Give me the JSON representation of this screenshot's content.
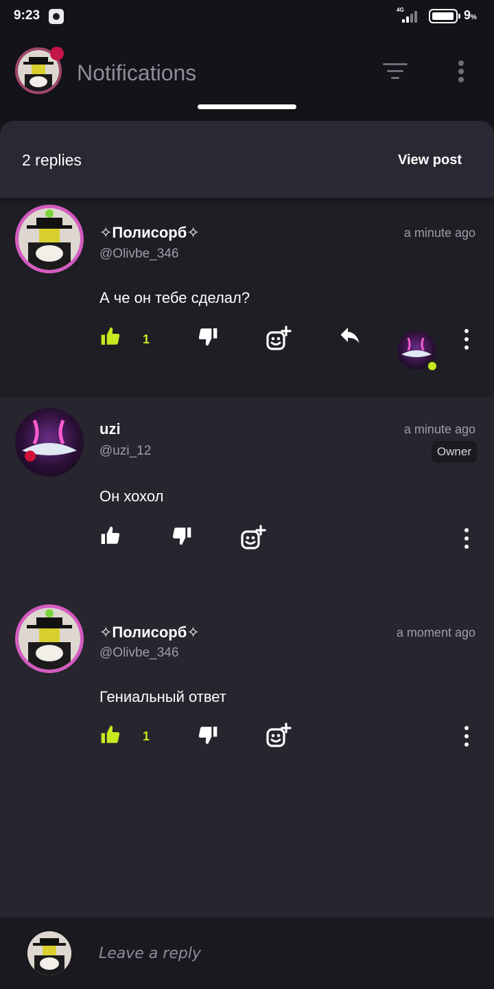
{
  "status_bar": {
    "time": "9:23",
    "network": "4G",
    "battery_percent": "9"
  },
  "header": {
    "title": "Notifications",
    "avatar_icon": "user-avatar-icon",
    "filter_icon": "filter-icon",
    "more_icon": "more-vertical-icon"
  },
  "thread": {
    "reply_count_label": "2 replies",
    "view_post_label": "View post"
  },
  "comments": [
    {
      "author": "✧Полисорб✧",
      "handle": "@Olivbe_346",
      "time": "a minute ago",
      "text": "А че он тебе сделал?",
      "likes": "1",
      "liked": true
    },
    {
      "author": "uzi",
      "handle": "@uzi_12",
      "time": "a minute ago",
      "badge": "Owner",
      "text": "Он хохол",
      "likes": "",
      "liked": false
    },
    {
      "author": "✧Полисорб✧",
      "handle": "@Olivbe_346",
      "time": "a moment ago",
      "text": "Гениальный ответ",
      "likes": "1",
      "liked": true
    }
  ],
  "reply_bar": {
    "placeholder": "Leave a reply"
  },
  "colors": {
    "accent": "#c6ea1f",
    "background": "#141319",
    "sheet": "#27252e",
    "notification_dot": "#c31547"
  }
}
